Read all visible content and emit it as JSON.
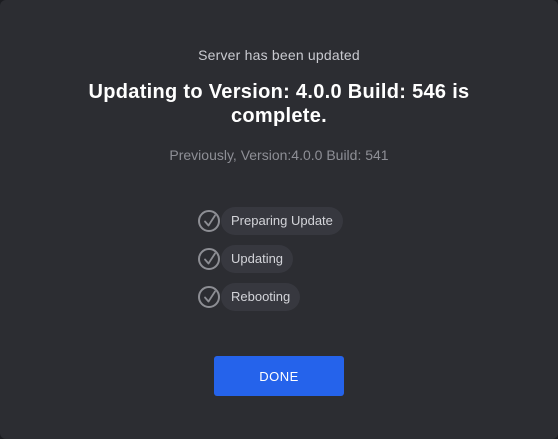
{
  "dialog": {
    "subtitle": "Server has been updated",
    "headline": "Updating to Version: 4.0.0 Build: 546 is complete.",
    "previous": "Previously, Version:4.0.0 Build: 541",
    "steps": [
      {
        "label": "Preparing Update",
        "icon": "checkmark-circle-icon",
        "status": "complete"
      },
      {
        "label": "Updating",
        "icon": "checkmark-circle-icon",
        "status": "complete"
      },
      {
        "label": "Rebooting",
        "icon": "checkmark-circle-icon",
        "status": "complete"
      }
    ],
    "done_label": "DONE"
  },
  "colors": {
    "background": "#2c2d32",
    "pill": "#37383f",
    "accent": "#2563eb",
    "muted_text": "#8e8f96"
  }
}
